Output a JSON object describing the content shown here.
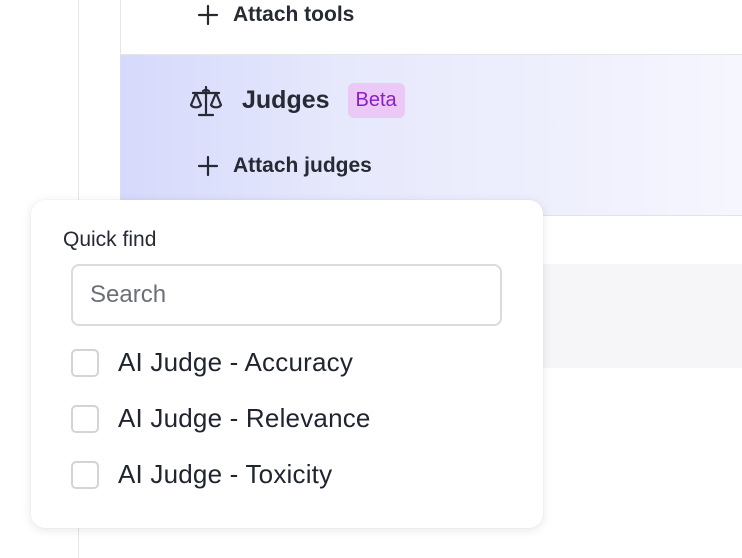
{
  "tools_section": {
    "attach_label": "Attach tools"
  },
  "judges_section": {
    "title": "Judges",
    "badge": "Beta",
    "attach_label": "Attach judges",
    "accent_bg": "#d6d9fb",
    "badge_bg": "#ecc8f6",
    "badge_color": "#8a1ec6"
  },
  "quick_find": {
    "label": "Quick find",
    "search_placeholder": "Search",
    "search_value": "",
    "options": [
      {
        "label": "AI Judge - Accuracy",
        "checked": false
      },
      {
        "label": "AI Judge - Relevance",
        "checked": false
      },
      {
        "label": "AI Judge - Toxicity",
        "checked": false
      }
    ]
  },
  "icons": {
    "plus": "plus-icon",
    "scale": "scale-icon",
    "checkbox": "checkbox"
  }
}
